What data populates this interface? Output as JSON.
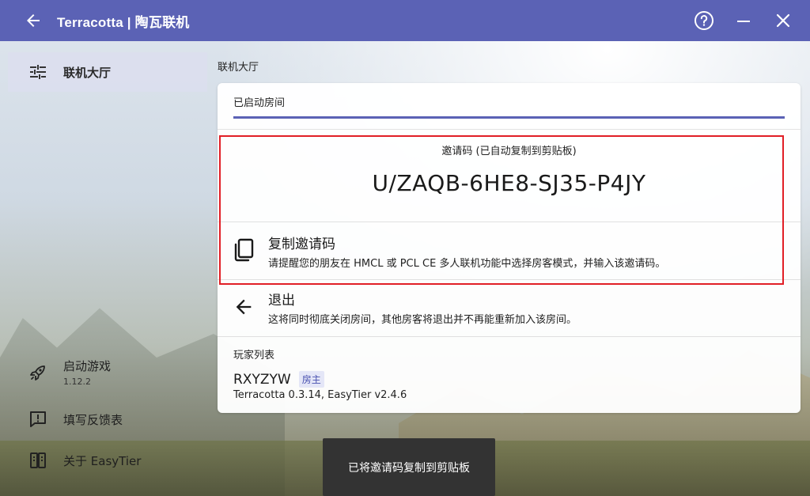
{
  "window": {
    "title": "Terracotta | 陶瓦联机",
    "icons": {
      "back": "arrow-left-icon",
      "help": "help-circle-icon",
      "minimize": "minimize-icon",
      "close": "close-icon"
    },
    "accent_color": "#5b62b5"
  },
  "sidebar": {
    "active_item": {
      "label": "联机大厅",
      "icon": "tune-sliders-icon"
    },
    "bottom_items": [
      {
        "label": "启动游戏",
        "sub": "1.12.2",
        "icon": "rocket-icon"
      },
      {
        "label": "填写反馈表",
        "icon": "feedback-icon"
      },
      {
        "label": "关于 EasyTier",
        "icon": "book-icon"
      }
    ]
  },
  "main": {
    "section_title": "联机大厅",
    "tab_label": "已启动房间",
    "invite": {
      "caption": "邀请码 (已自动复制到剪贴板)",
      "code": "U/ZAQB-6HE8-SJ35-P4JY",
      "highlight_color": "#e11f26"
    },
    "copy_action": {
      "title": "复制邀请码",
      "description": "请提醒您的朋友在 HMCL 或 PCL CE 多人联机功能中选择房客模式，并输入该邀请码。",
      "icon": "copy-icon"
    },
    "exit_action": {
      "title": "退出",
      "description": "这将同时彻底关闭房间，其他房客将退出并不再能重新加入该房间。",
      "icon": "arrow-left-icon"
    },
    "players": {
      "title": "玩家列表",
      "list": [
        {
          "name": "RXYZYW",
          "role": "房主",
          "info": "Terracotta 0.3.14, EasyTier v2.4.6"
        }
      ]
    }
  },
  "toast": {
    "message": "已将邀请码复制到剪贴板"
  }
}
